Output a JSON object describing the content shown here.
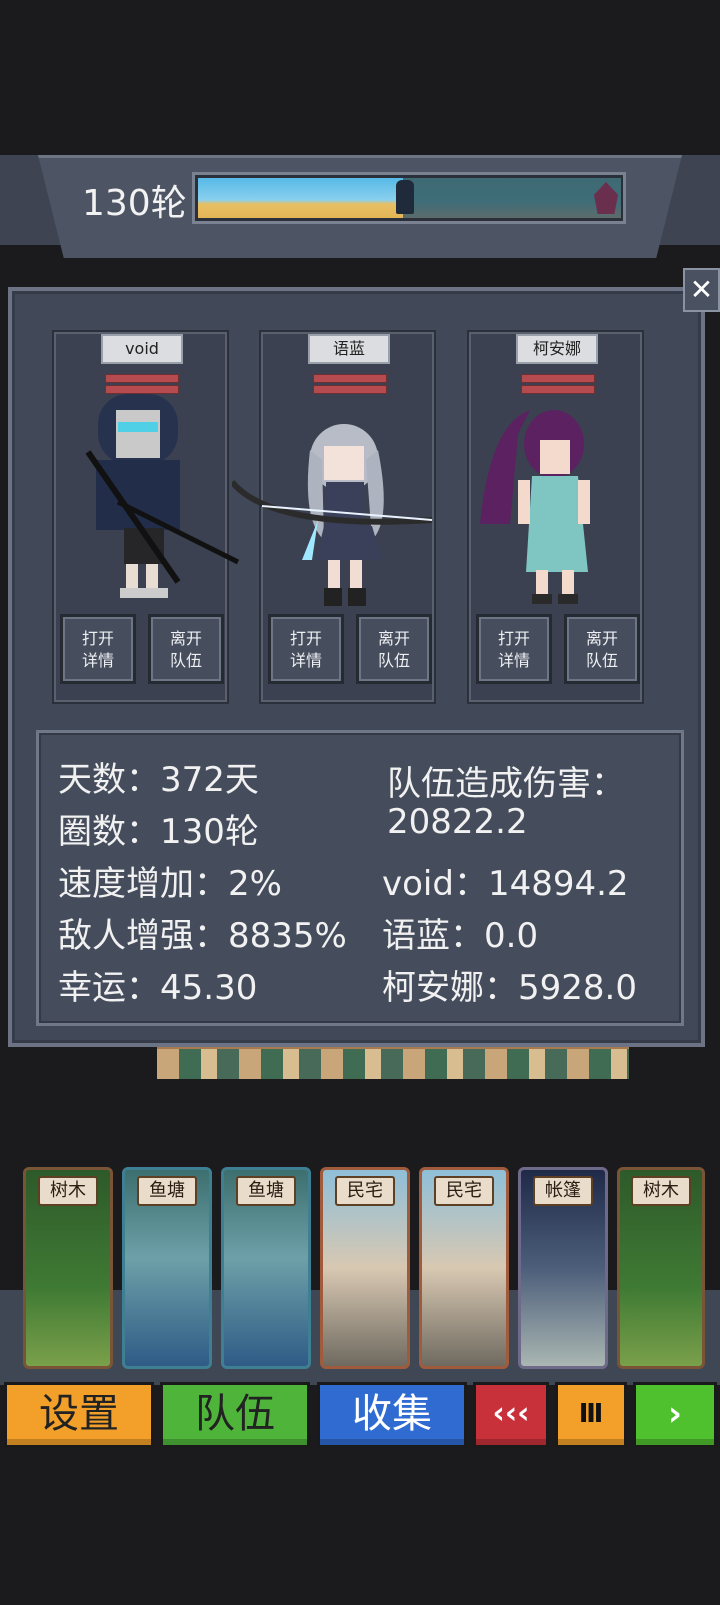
{
  "header": {
    "round_label": "130轮"
  },
  "close_label": "✕",
  "party": [
    {
      "name": "void",
      "open_label": "打开\n详情",
      "leave_label": "离开\n队伍"
    },
    {
      "name": "语蓝",
      "open_label": "打开\n详情",
      "leave_label": "离开\n队伍"
    },
    {
      "name": "柯安娜",
      "open_label": "打开\n详情",
      "leave_label": "离开\n队伍"
    }
  ],
  "stats": {
    "days": "天数：372天",
    "rounds": "圈数：130轮",
    "speed": "速度增加：2%",
    "enemy": "敌人增强：8835%",
    "luck": "幸运：45.30",
    "team_damage_label": "队伍造成伤害：",
    "team_damage_value": "20822.2",
    "void_damage": "void：14894.2",
    "yulan_damage": "语蓝：0.0",
    "keanna_damage": "柯安娜：5928.0"
  },
  "deck": [
    {
      "label": "树木",
      "kind": "forest"
    },
    {
      "label": "鱼塘",
      "kind": "pond"
    },
    {
      "label": "鱼塘",
      "kind": "pond"
    },
    {
      "label": "民宅",
      "kind": "house"
    },
    {
      "label": "民宅",
      "kind": "house"
    },
    {
      "label": "帐篷",
      "kind": "tent"
    },
    {
      "label": "树木",
      "kind": "forest"
    }
  ],
  "bottom_bar": {
    "settings": "设置",
    "team": "队伍",
    "collect": "收集",
    "rewind": "‹‹‹",
    "pause": "Ⅲ",
    "play": "›"
  },
  "colors": {
    "settings": "#f3a02a",
    "team": "#4fb53a",
    "collect": "#2f6bd0",
    "rewind": "#c8313a",
    "pause": "#f3a02a",
    "play": "#4fc02e"
  }
}
